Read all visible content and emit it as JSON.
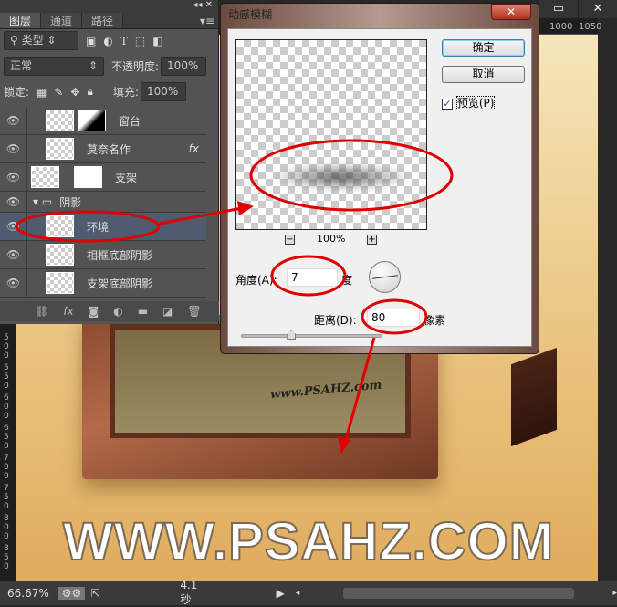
{
  "window": {
    "buttons": [
      "▭",
      "✕"
    ],
    "ruler_top": [
      "1000",
      "1050"
    ],
    "ruler_left": [
      "500",
      "550",
      "600",
      "650",
      "700",
      "750",
      "800",
      "850"
    ]
  },
  "layers_panel": {
    "collapse": "◂◂ ✕",
    "tabs": [
      {
        "label": "图层",
        "active": true
      },
      {
        "label": "通道"
      },
      {
        "label": "路径"
      }
    ],
    "menu_icon": "▾≡",
    "filter": {
      "label": "类型",
      "icons": [
        "image-icon",
        "adjustment-icon",
        "type-icon",
        "shape-icon",
        "smart-object-icon"
      ]
    },
    "blend_mode": "正常",
    "opacity_label": "不透明度:",
    "opacity": "100%",
    "lock_label": "锁定:",
    "fill_label": "填充:",
    "fill": "100%",
    "layers": [
      {
        "name": "窗台",
        "visible": true,
        "mask": true
      },
      {
        "name": "莫奈名作",
        "visible": true,
        "fx": "fx"
      },
      {
        "name": "支架",
        "visible": true,
        "mask": true
      },
      {
        "name": "阴影",
        "visible": true,
        "group": true
      },
      {
        "name": "环境",
        "visible": true,
        "selected": true
      },
      {
        "name": "相框底部阴影",
        "visible": true
      },
      {
        "name": "支架底部阴影",
        "visible": true
      }
    ],
    "bottom_icons": [
      "link-icon",
      "fx-icon",
      "mask-icon",
      "adjustment-icon",
      "folder-icon",
      "new-layer-icon",
      "trash-icon"
    ]
  },
  "canvas": {
    "frame_watermark": "www.PSAHZ.com",
    "big_text": "WWW.PSAHZ.COM"
  },
  "dialog": {
    "title": "动感模糊",
    "close": "✕",
    "ok": "确定",
    "cancel": "取消",
    "preview_label": "预览(P)",
    "preview_checked": true,
    "zoom": "100%",
    "zoom_out": "−",
    "zoom_in": "+",
    "angle_label": "角度(A):",
    "angle": "7",
    "angle_unit": "度",
    "distance_label": "距离(D):",
    "distance": "80",
    "distance_unit": "像素",
    "distance_slider_fraction": 0.35
  },
  "status": {
    "zoom": "66.67%",
    "time": "4.1 秒"
  },
  "annotation_color": "#e00000"
}
